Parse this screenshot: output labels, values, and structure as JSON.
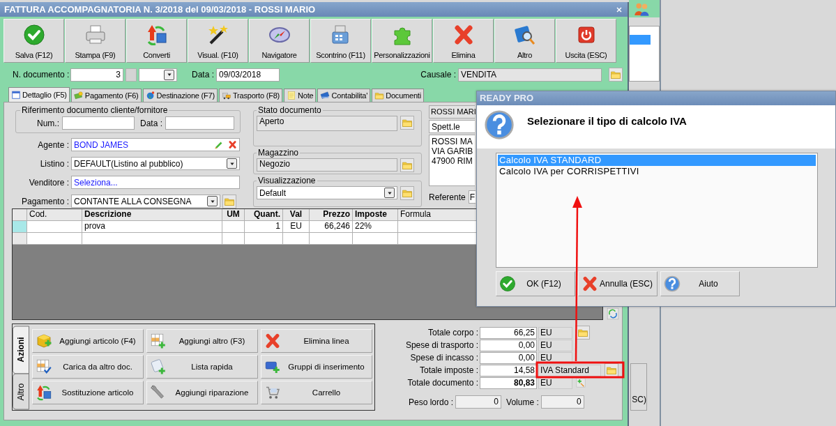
{
  "window": {
    "title": "FATTURA ACCOMPAGNATORIA N. 3/2018 del 09/03/2018 - ROSSI MARIO"
  },
  "toolbar": [
    "Salva (F12)",
    "Stampa (F9)",
    "Converti",
    "Visual. (F10)",
    "Navigatore",
    "Scontrino (F11)",
    "Personalizzazioni",
    "Elimina",
    "Altro",
    "Uscita (ESC)"
  ],
  "header": {
    "number_label": "N. documento :",
    "number": "3",
    "date_label": "Data :",
    "date": "09/03/2018",
    "causale_label": "Causale :",
    "causale": "VENDITA"
  },
  "tabs": [
    {
      "label": "Dettaglio (F5)",
      "selected": true
    },
    {
      "label": "Pagamento (F6)",
      "selected": false
    },
    {
      "label": "Destinazione (F7)",
      "selected": false
    },
    {
      "label": "Trasporto (F8)",
      "selected": false
    },
    {
      "label": "Note",
      "selected": false
    },
    {
      "label": "Contabilita'",
      "selected": false
    },
    {
      "label": "Documenti",
      "selected": false
    }
  ],
  "reference": {
    "legend": "Riferimento documento cliente/fornitore",
    "num_label": "Num.:",
    "date_label": "Data :"
  },
  "fields": [
    {
      "label": "Agente :",
      "value": "BOND JAMES",
      "kind": "agent"
    },
    {
      "label": "Listino :",
      "value": "DEFAULT(Listino al pubblico)",
      "kind": "select"
    },
    {
      "label": "Venditore :",
      "value": "Seleziona...",
      "kind": "link"
    },
    {
      "label": "Pagamento :",
      "value": "CONTANTE ALLA CONSEGNA",
      "kind": "select-folder"
    }
  ],
  "groups": [
    {
      "legend": "Stato documento",
      "value": "Aperto",
      "kind": "readonly"
    },
    {
      "legend": "Magazzino",
      "value": "Negozio",
      "kind": "readonly"
    },
    {
      "legend": "Visualizzazione",
      "value": "Default",
      "kind": "select"
    }
  ],
  "customer": {
    "name": "ROSSI MARI",
    "salutation": "Spett.le",
    "address": [
      "ROSSI MA",
      "VIA GARIB",
      "47900 RIM"
    ],
    "referente_label": "Referente",
    "referente": "F"
  },
  "grid": {
    "columns": [
      {
        "label": "Cod.",
        "bold": false
      },
      {
        "label": "Descrizione",
        "bold": true
      },
      {
        "label": "UM",
        "bold": true
      },
      {
        "label": "Quant.",
        "bold": true
      },
      {
        "label": "Val",
        "bold": true
      },
      {
        "label": "Prezzo",
        "bold": true
      },
      {
        "label": "Imposte",
        "bold": true
      },
      {
        "label": "Formula",
        "bold": false
      }
    ],
    "rows": [
      {
        "selected": true,
        "descrizione": "prova",
        "quant": "1",
        "val": "EU",
        "prezzo": "66,246",
        "imposte": "22%"
      }
    ]
  },
  "actions": {
    "tabs": [
      {
        "label": "Azioni",
        "selected": true
      },
      {
        "label": "Altro",
        "selected": false
      }
    ],
    "buttons": [
      "Aggiungi articolo (F4)",
      "Aggiungi altro (F3)",
      "Elimina linea",
      "Carica da altro doc.",
      "Lista rapida",
      "Gruppi di inserimento",
      "Sostituzione articolo",
      "Aggiungi riparazione",
      "Carrello"
    ]
  },
  "totals": [
    {
      "label": "Totale corpo :",
      "value": "66,25",
      "unit": "EU",
      "kind": "folder",
      "bold": false
    },
    {
      "label": "Spese di trasporto :",
      "value": "0,00",
      "unit": "EU",
      "kind": "plain",
      "bold": false
    },
    {
      "label": "Spese di incasso :",
      "value": "0,00",
      "unit": "EU",
      "kind": "plain",
      "bold": false
    },
    {
      "label": "Totale imposte :",
      "value": "14,58",
      "unit": "IVA Standard",
      "kind": "wide-folder",
      "bold": false
    },
    {
      "label": "Totale documento :",
      "value": "80,83",
      "unit": "EU",
      "kind": "add",
      "bold": true
    }
  ],
  "measures": [
    {
      "label": "Peso lordo :",
      "value": "0"
    },
    {
      "label": "Volume :",
      "value": "0"
    }
  ],
  "dialog": {
    "title": "READY PRO",
    "message": "Selezionare il tipo di calcolo IVA",
    "options": [
      {
        "label": "Calcolo IVA STANDARD",
        "selected": true
      },
      {
        "label": "Calcolo IVA per CORRISPETTIVI",
        "selected": false
      }
    ],
    "buttons": [
      "OK (F12)",
      "Annulla (ESC)",
      "Aiuto"
    ]
  },
  "background": {
    "button_text": "SC)"
  }
}
